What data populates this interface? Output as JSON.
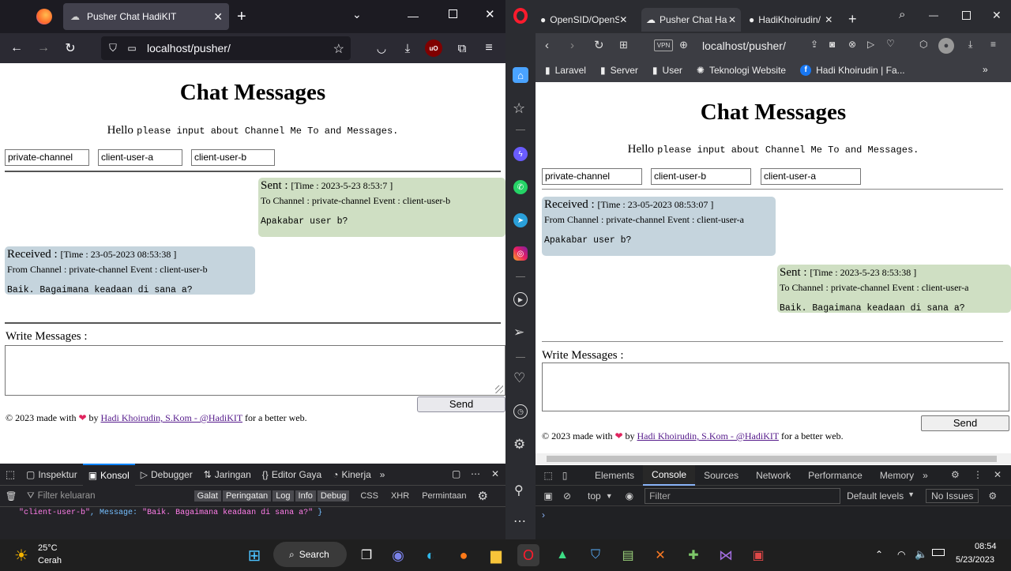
{
  "left": {
    "tab_title": "Pusher Chat HadiKIT",
    "url": "localhost/pusher/",
    "page": {
      "title": "Chat Messages",
      "hello": "Hello",
      "hello_sub": "please input about Channel Me To and Messages.",
      "inputs": [
        "private-channel",
        "client-user-a",
        "client-user-b"
      ],
      "sent": {
        "label": "Sent :",
        "time": "[Time : 2023-5-23 8:53:7 ]",
        "info": "To Channel : private-channel Event : client-user-b",
        "msg": "Apakabar user b?"
      },
      "received": {
        "label": "Received :",
        "time": "[Time : 23-05-2023 08:53:38 ]",
        "info": "From Channel : private-channel Event : client-user-b",
        "msg": "Baik. Bagaimana keadaan di sana a?"
      },
      "write_label": "Write Messages :",
      "send": "Send",
      "footer_pre": "© 2023 made with",
      "footer_by": "by",
      "footer_link": "Hadi Khoirudin, S.Kom - @HadiKIT",
      "footer_post": "for a better web."
    },
    "devtools": {
      "tabs": [
        "Inspektur",
        "Konsol",
        "Debugger",
        "Jaringan",
        "Editor Gaya",
        "Kinerja"
      ],
      "filter_placeholder": "Filter keluaran",
      "levels": [
        "Galat",
        "Peringatan",
        "Log",
        "Info",
        "Debug"
      ],
      "extras": [
        "CSS",
        "XHR",
        "Permintaan"
      ],
      "log_event": "\"client-user-b\"",
      "log_key": "Message",
      "log_value": "\"Baik. Bagaimana keadaan di sana a?\""
    }
  },
  "right": {
    "tabs": [
      "OpenSID/OpenS",
      "Pusher Chat Ha",
      "HadiKhoirudin/"
    ],
    "url": "localhost/pusher/",
    "bookmarks": [
      "Laravel",
      "Server",
      "User",
      "Teknologi Website",
      "Hadi Khoirudin | Fa..."
    ],
    "page": {
      "title": "Chat Messages",
      "hello": "Hello",
      "hello_sub": "please input about Channel Me To and Messages.",
      "inputs": [
        "private-channel",
        "client-user-b",
        "client-user-a"
      ],
      "received": {
        "label": "Received :",
        "time": "[Time : 23-05-2023 08:53:07 ]",
        "info": "From Channel : private-channel Event : client-user-a",
        "msg": "Apakabar user b?"
      },
      "sent": {
        "label": "Sent :",
        "time": "[Time : 2023-5-23 8:53:38 ]",
        "info": "To Channel : private-channel Event : client-user-a",
        "msg": "Baik. Bagaimana keadaan di sana a?"
      },
      "write_label": "Write Messages :",
      "send": "Send",
      "footer_pre": "© 2023 made with",
      "footer_by": "by",
      "footer_link": "Hadi Khoirudin, S.Kom - @HadiKIT",
      "footer_post": "for a better web."
    },
    "devtools": {
      "tabs": [
        "Elements",
        "Console",
        "Sources",
        "Network",
        "Performance",
        "Memory"
      ],
      "context": "top",
      "filter_placeholder": "Filter",
      "levels": "Default levels",
      "issues": "No Issues"
    }
  },
  "taskbar": {
    "temp": "25°C",
    "weather": "Cerah",
    "search": "Search",
    "time": "08:54",
    "date": "5/23/2023"
  },
  "colors": {
    "sent": "#cfdfc3",
    "received": "#c5d4dd",
    "ff_dark": "#1c1b22",
    "opera_red": "#ff1b2d"
  }
}
